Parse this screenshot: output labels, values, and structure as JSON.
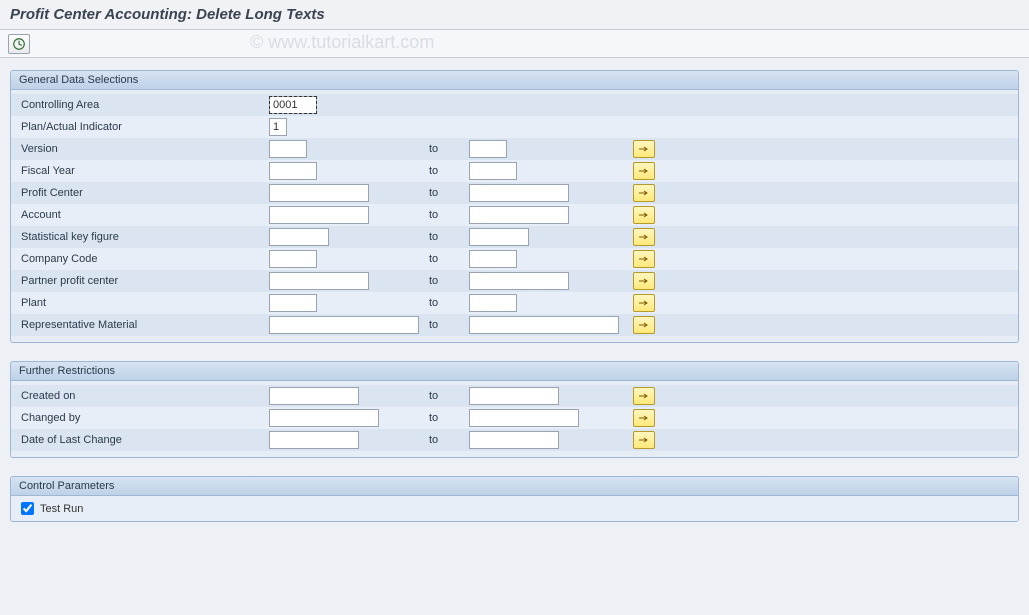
{
  "title": "Profit Center Accounting: Delete Long Texts",
  "watermark": "© www.tutorialkart.com",
  "groups": {
    "general": {
      "header": "General Data Selections",
      "rows": {
        "controllingArea": {
          "label": "Controlling Area",
          "from": "0001"
        },
        "planActual": {
          "label": "Plan/Actual Indicator",
          "from": "1"
        },
        "version": {
          "label": "Version",
          "to_label": "to",
          "from": "",
          "to": ""
        },
        "fiscalYear": {
          "label": "Fiscal Year",
          "to_label": "to",
          "from": "",
          "to": ""
        },
        "profitCenter": {
          "label": "Profit Center",
          "to_label": "to",
          "from": "",
          "to": ""
        },
        "account": {
          "label": "Account",
          "to_label": "to",
          "from": "",
          "to": ""
        },
        "statKeyFigure": {
          "label": "Statistical key figure",
          "to_label": "to",
          "from": "",
          "to": ""
        },
        "companyCode": {
          "label": "Company Code",
          "to_label": "to",
          "from": "",
          "to": ""
        },
        "partnerPC": {
          "label": "Partner profit center",
          "to_label": "to",
          "from": "",
          "to": ""
        },
        "plant": {
          "label": "Plant",
          "to_label": "to",
          "from": "",
          "to": ""
        },
        "repMaterial": {
          "label": "Representative Material",
          "to_label": "to",
          "from": "",
          "to": ""
        }
      }
    },
    "further": {
      "header": "Further Restrictions",
      "rows": {
        "createdOn": {
          "label": "Created on",
          "to_label": "to",
          "from": "",
          "to": ""
        },
        "changedBy": {
          "label": "Changed by",
          "to_label": "to",
          "from": "",
          "to": ""
        },
        "lastChange": {
          "label": "Date of Last Change",
          "to_label": "to",
          "from": "",
          "to": ""
        }
      }
    },
    "control": {
      "header": "Control Parameters",
      "testRun": {
        "label": "Test Run",
        "checked": true
      }
    }
  }
}
